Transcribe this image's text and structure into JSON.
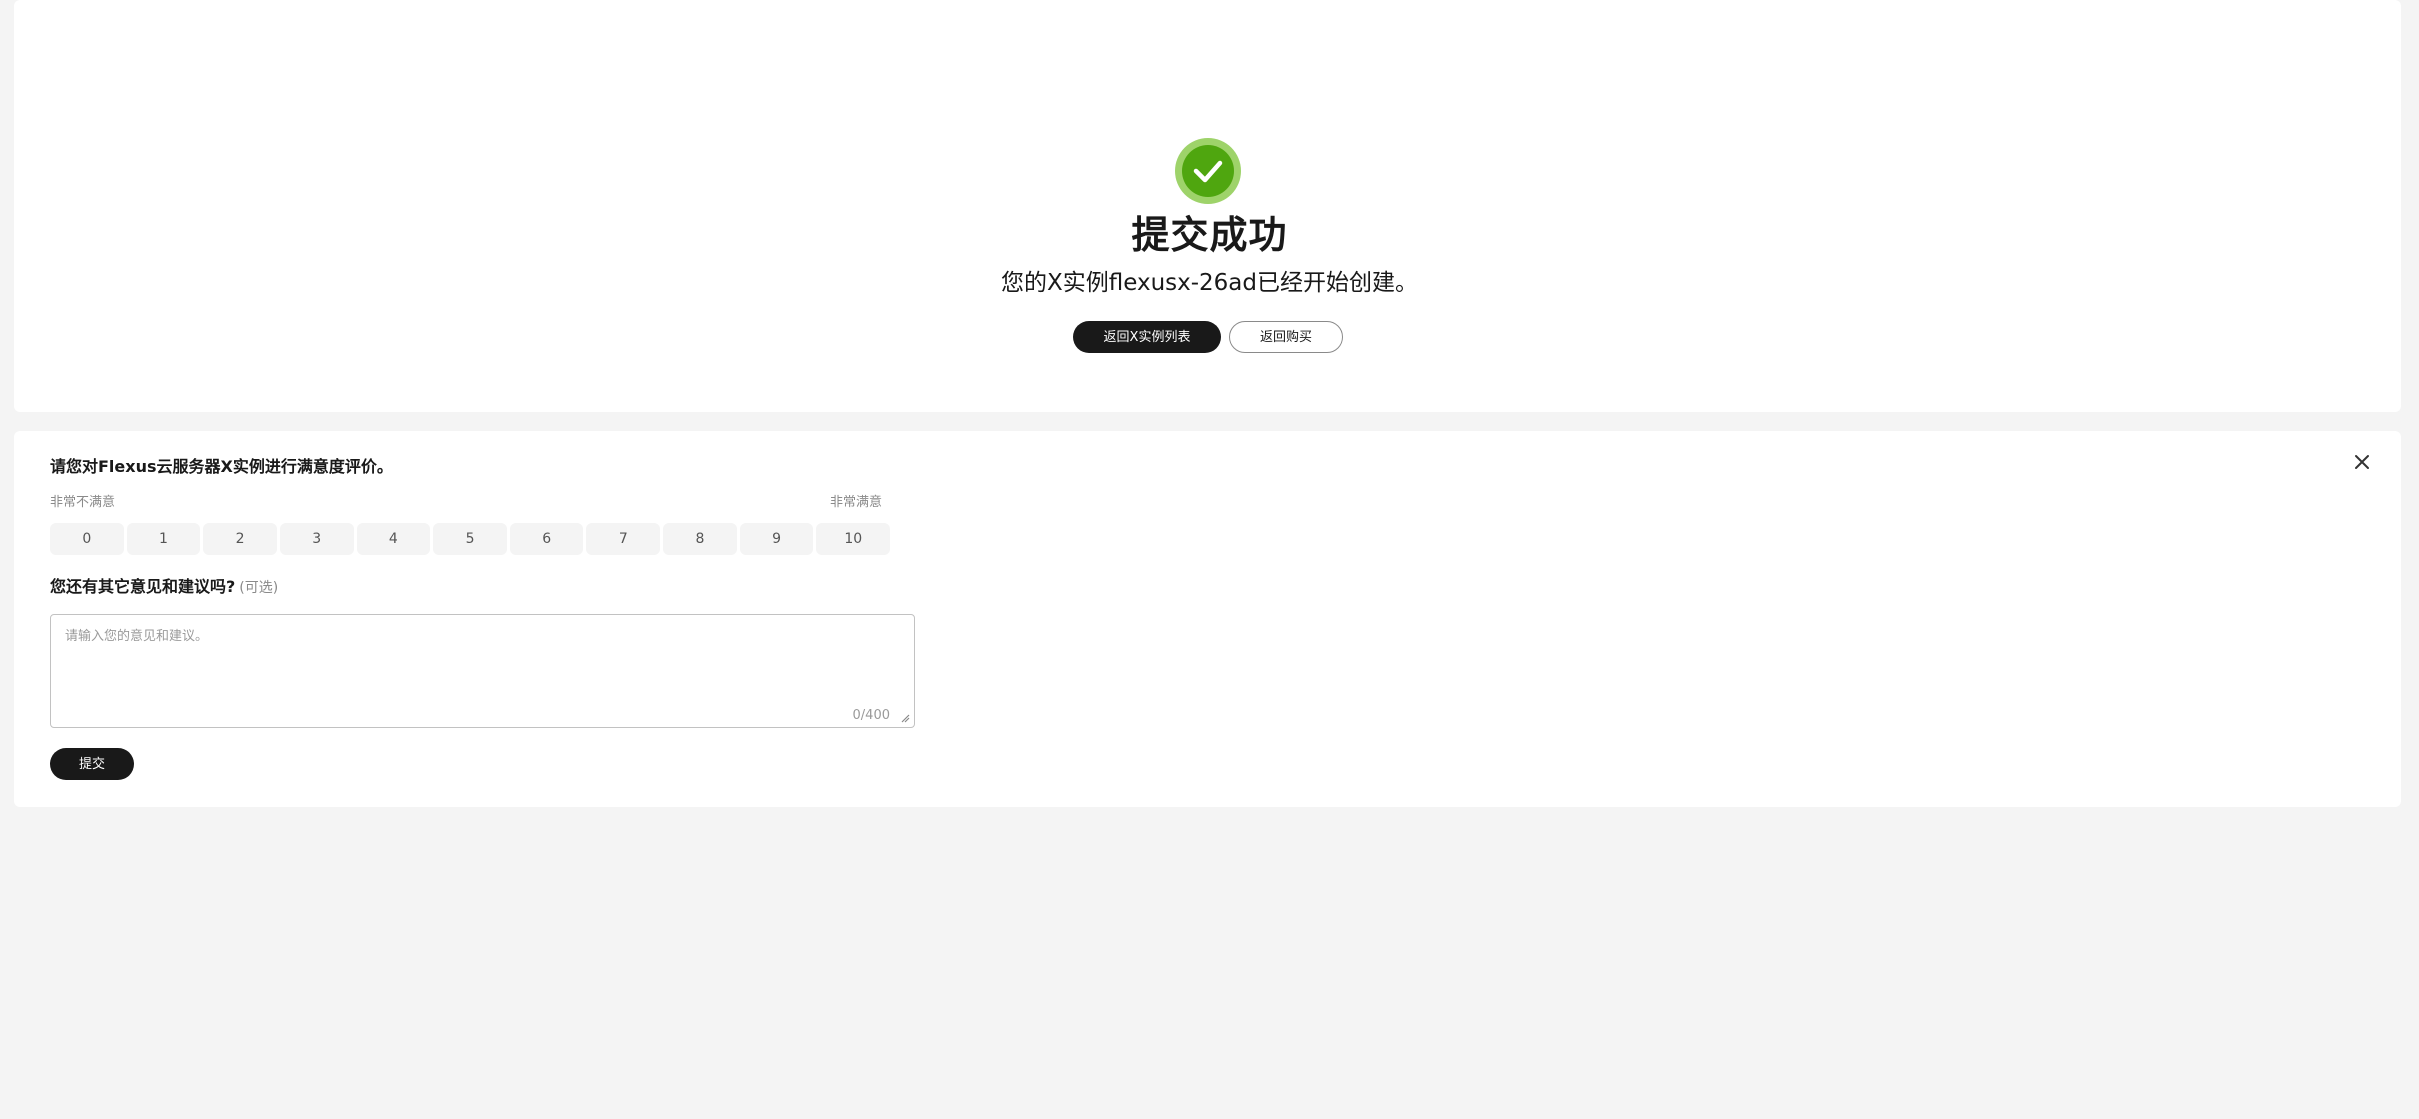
{
  "success": {
    "title": "提交成功",
    "description": "您的X实例flexusx-26ad已经开始创建。",
    "primary_button": "返回X实例列表",
    "secondary_button": "返回购买",
    "icon": "check-circle-icon",
    "icon_color": "#4fa60f"
  },
  "survey": {
    "question1": "请您对Flexus云服务器X实例进行满意度评价。",
    "scale_left_label": "非常不满意",
    "scale_right_label": "非常满意",
    "scale": [
      "0",
      "1",
      "2",
      "3",
      "4",
      "5",
      "6",
      "7",
      "8",
      "9",
      "10"
    ],
    "question2": "您还有其它意见和建议吗?",
    "question2_optional": "(可选)",
    "textarea_placeholder": "请输入您的意见和建议。",
    "textarea_value": "",
    "counter": "0/400",
    "submit_button": "提交",
    "close_icon": "close-icon"
  }
}
